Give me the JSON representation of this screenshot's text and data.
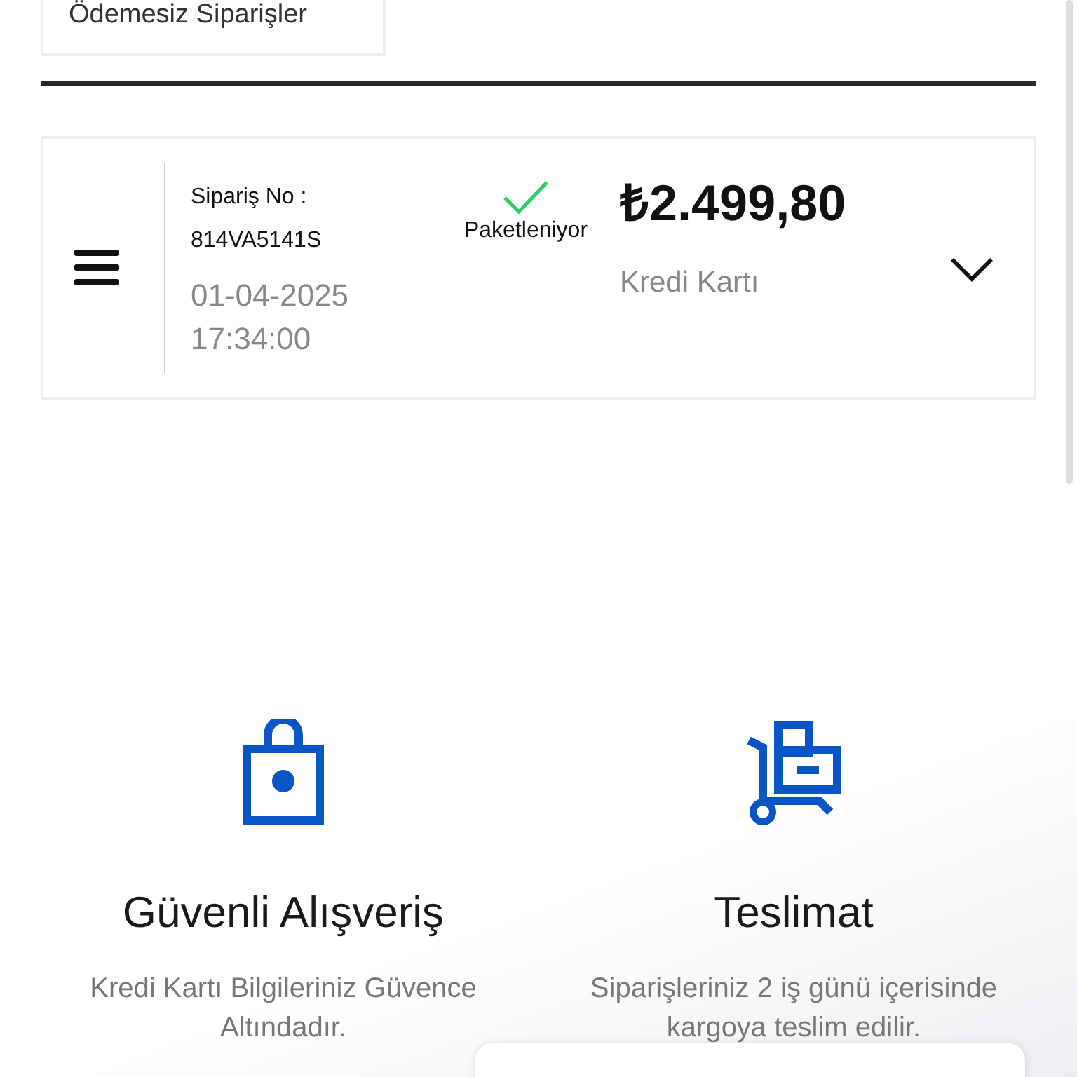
{
  "tab": {
    "label": "Ödemesiz Siparişler"
  },
  "order": {
    "number_label": "Sipariş No :",
    "number": "814VA5141S",
    "date": "01-04-2025",
    "time": "17:34:00",
    "status": "Paketleniyor",
    "status_done": true,
    "total": "₺2.499,80",
    "payment": "Kredi Kartı",
    "expanded": false
  },
  "features": [
    {
      "kind": "secure",
      "title": "Güvenli Alışveriş",
      "text": "Kredi Kartı Bilgileriniz Güvence Altındadır."
    },
    {
      "kind": "delivery",
      "title": "Teslimat",
      "text": "Siparişleriniz 2 iş günü içerisinde kargoya teslim edilir."
    }
  ]
}
